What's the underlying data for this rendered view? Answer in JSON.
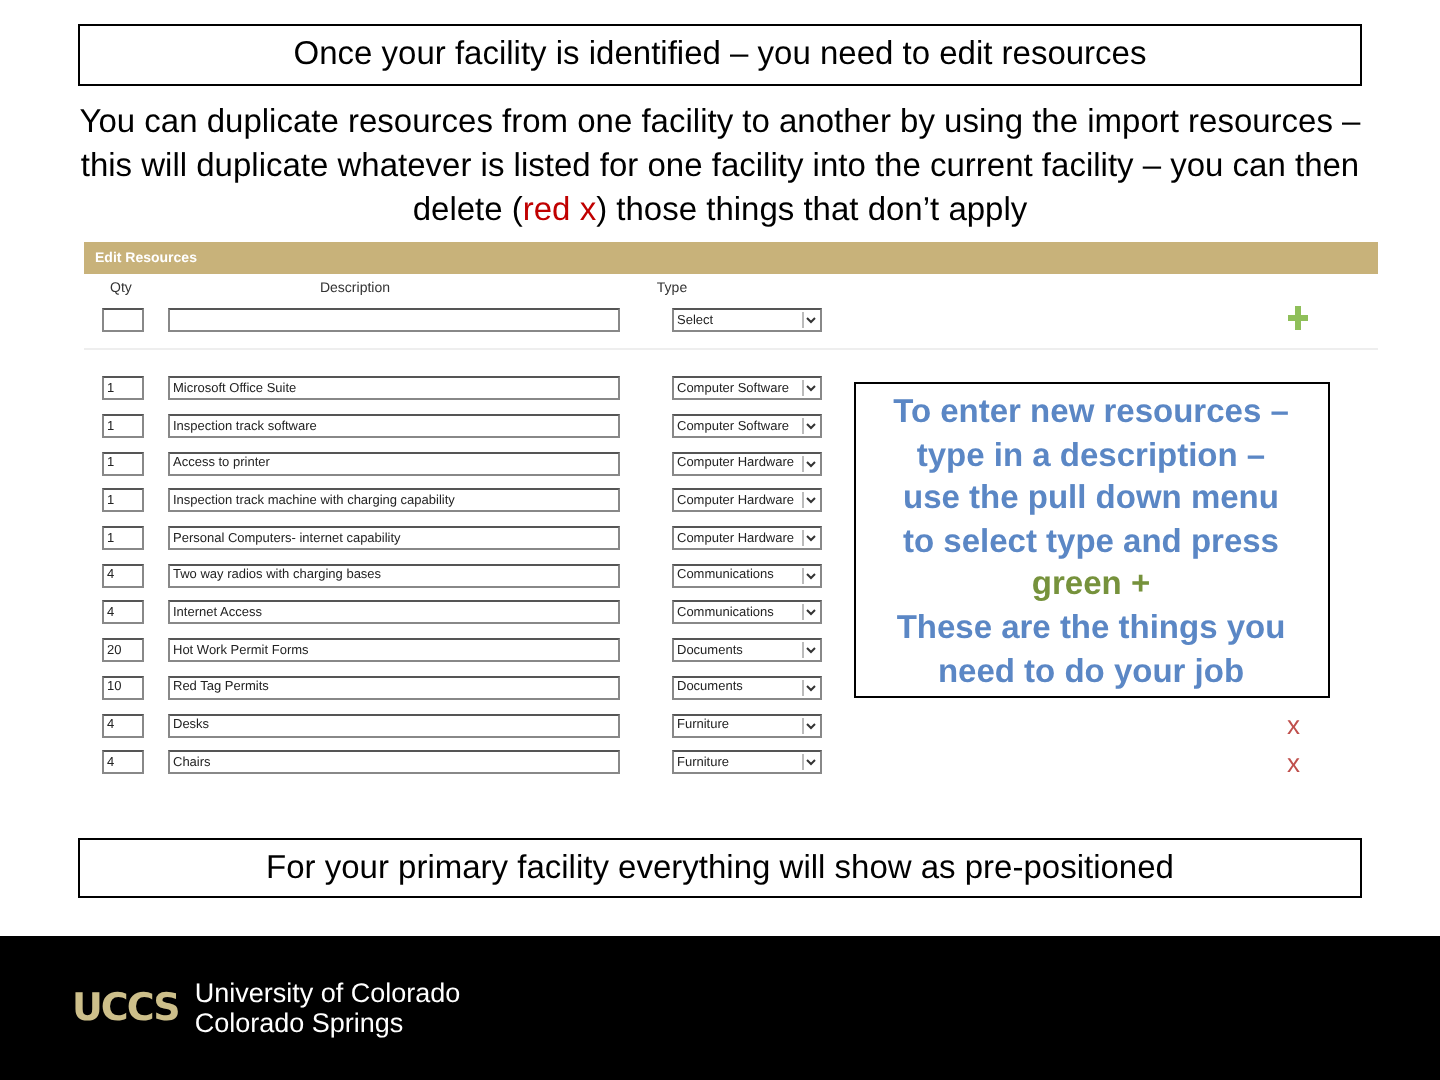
{
  "title": "Once your facility is identified – you need to edit resources",
  "intro": {
    "before": "You can duplicate resources from one facility to another by using the import resources – this will duplicate whatever is listed for one facility into the current facility – you can then delete (",
    "highlight": "red x",
    "after": ") those things that don’t apply"
  },
  "form": {
    "header": "Edit Resources",
    "columns": [
      "Qty",
      "Description",
      "Type"
    ],
    "new_row": {
      "type": "Select"
    },
    "rows": [
      {
        "qty": "1",
        "description": "Microsoft Office Suite",
        "type": "Computer Software"
      },
      {
        "qty": "1",
        "description": "Inspection track software",
        "type": "Computer Software"
      },
      {
        "qty": "1",
        "description": "Access to printer",
        "type": "Computer Hardware"
      },
      {
        "qty": "1",
        "description": "Inspection track machine with charging capability",
        "type": "Computer Hardware"
      },
      {
        "qty": "1",
        "description": "Personal Computers- internet capability",
        "type": "Computer Hardware"
      },
      {
        "qty": "4",
        "description": "Two way radios with charging bases",
        "type": "Communications"
      },
      {
        "qty": "4",
        "description": "Internet Access",
        "type": "Communications"
      },
      {
        "qty": "20",
        "description": "Hot Work Permit Forms",
        "type": "Documents"
      },
      {
        "qty": "10",
        "description": "Red Tag Permits",
        "type": "Documents"
      },
      {
        "qty": "4",
        "description": "Desks",
        "type": "Furniture",
        "delete": "x"
      },
      {
        "qty": "4",
        "description": "Chairs",
        "type": "Furniture",
        "delete": "x"
      }
    ]
  },
  "callout": {
    "lines_before": [
      "To enter new resources –",
      "type in a description –",
      "use the pull down menu",
      "to select type and press"
    ],
    "highlight": "green +",
    "lines_after": [
      "These are the things you",
      "need to do your job"
    ]
  },
  "note": "For  your primary facility everything will show as pre-positioned",
  "footer": {
    "logo": "UCCS",
    "lines": [
      "University of Colorado",
      "Colorado Springs"
    ]
  }
}
